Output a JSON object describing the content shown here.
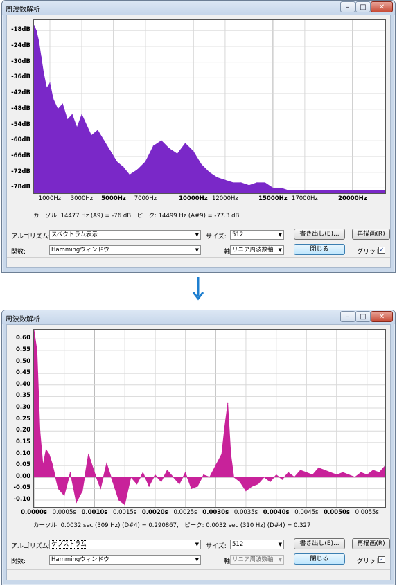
{
  "window_title": "周波数解析",
  "colors": {
    "spectrum": "#7a28c8",
    "cepstrum": "#c8229a",
    "transition_arrow": "#1e7fd0"
  },
  "icons": {
    "transition": "down-arrow-icon",
    "minimize": "minimize-icon",
    "maximize": "maximize-icon",
    "close": "close-icon",
    "check": "check-icon"
  },
  "window_buttons": {
    "minimize": "–",
    "maximize": "□",
    "close": "✕"
  },
  "top": {
    "chart_data": {
      "type": "area",
      "title": "",
      "xlabel": "",
      "ylabel": "",
      "ylim": [
        -80,
        -14
      ],
      "xlim": [
        0,
        22050
      ],
      "grid": true,
      "y_ticks": [
        "-18dB",
        "-24dB",
        "-30dB",
        "-36dB",
        "-42dB",
        "-48dB",
        "-54dB",
        "-60dB",
        "-66dB",
        "-72dB",
        "-78dB"
      ],
      "x_ticks": [
        {
          "label": "1000Hz",
          "value": 1000,
          "bold": false
        },
        {
          "label": "3000Hz",
          "value": 3000,
          "bold": false
        },
        {
          "label": "5000Hz",
          "value": 5000,
          "bold": true
        },
        {
          "label": "7000Hz",
          "value": 7000,
          "bold": false
        },
        {
          "label": "10000Hz",
          "value": 10000,
          "bold": true
        },
        {
          "label": "12000Hz",
          "value": 12000,
          "bold": false
        },
        {
          "label": "15000Hz",
          "value": 15000,
          "bold": true
        },
        {
          "label": "17000Hz",
          "value": 17000,
          "bold": false
        },
        {
          "label": "20000Hz",
          "value": 20000,
          "bold": true
        }
      ],
      "x": [
        0,
        150,
        300,
        450,
        600,
        800,
        1000,
        1200,
        1500,
        1800,
        2100,
        2400,
        2700,
        3000,
        3300,
        3600,
        4000,
        4400,
        4800,
        5200,
        5600,
        6000,
        6500,
        7000,
        7500,
        8000,
        8500,
        9000,
        9500,
        10000,
        10500,
        11000,
        11500,
        12000,
        12500,
        13000,
        13500,
        14000,
        14500,
        15000,
        15500,
        16000,
        17000,
        18000,
        19000,
        20000,
        21000,
        22050
      ],
      "y": [
        -16,
        -18,
        -22,
        -28,
        -34,
        -40,
        -38,
        -44,
        -48,
        -46,
        -52,
        -50,
        -55,
        -50,
        -54,
        -58,
        -56,
        -60,
        -64,
        -68,
        -70,
        -73,
        -71,
        -68,
        -62,
        -60,
        -63,
        -65,
        -61,
        -64,
        -69,
        -72,
        -74,
        -75,
        -76,
        -76,
        -77,
        -76,
        -76,
        -78,
        -78,
        -79,
        -79,
        -79,
        -79,
        -79,
        -79,
        -79
      ]
    },
    "readout": "カーソル: 14477 Hz (A9) = -76 dB　ピーク: 14499 Hz (A#9) = -77.3 dB",
    "controls": {
      "algorithm_label": "アルゴリズム:",
      "algorithm_value": "スペクトラム表示",
      "function_label": "関数:",
      "function_value": "Hammingウィンドウ",
      "size_label": "サイズ:",
      "size_value": "512",
      "axis_label": "軸:",
      "axis_value": "リニア周波数軸",
      "export_button": "書き出し(E)...",
      "replot_button": "再描画(R)",
      "close_button": "閉じる",
      "grid_label": "グリッド",
      "grid_checked": true
    }
  },
  "bottom": {
    "chart_data": {
      "type": "area",
      "title": "",
      "xlabel": "",
      "ylabel": "",
      "ylim": [
        -0.13,
        0.64
      ],
      "xlim": [
        0,
        0.0058
      ],
      "grid": true,
      "y_ticks": [
        "0.60",
        "0.55",
        "0.50",
        "0.45",
        "0.40",
        "0.35",
        "0.30",
        "0.25",
        "0.20",
        "0.15",
        "0.10",
        "0.05",
        "0.00",
        "-0.05",
        "-0.10"
      ],
      "x_ticks": [
        {
          "label": "0.0000s",
          "value": 0.0,
          "bold": true
        },
        {
          "label": "0.0005s",
          "value": 0.0005,
          "bold": false
        },
        {
          "label": "0.0010s",
          "value": 0.001,
          "bold": true
        },
        {
          "label": "0.0015s",
          "value": 0.0015,
          "bold": false
        },
        {
          "label": "0.0020s",
          "value": 0.002,
          "bold": true
        },
        {
          "label": "0.0025s",
          "value": 0.0025,
          "bold": false
        },
        {
          "label": "0.0030s",
          "value": 0.003,
          "bold": true
        },
        {
          "label": "0.0035s",
          "value": 0.0035,
          "bold": false
        },
        {
          "label": "0.0040s",
          "value": 0.004,
          "bold": true
        },
        {
          "label": "0.0045s",
          "value": 0.0045,
          "bold": false
        },
        {
          "label": "0.0050s",
          "value": 0.005,
          "bold": true
        },
        {
          "label": "0.0055s",
          "value": 0.0055,
          "bold": false
        }
      ],
      "x": [
        0,
        5e-05,
        0.0001,
        0.00015,
        0.0002,
        0.00025,
        0.0003,
        0.0004,
        0.0005,
        0.0006,
        0.0007,
        0.0008,
        0.0009,
        0.001,
        0.0011,
        0.0012,
        0.0013,
        0.0014,
        0.0015,
        0.0016,
        0.0017,
        0.0018,
        0.0019,
        0.002,
        0.0021,
        0.0022,
        0.0023,
        0.0024,
        0.0025,
        0.0026,
        0.0027,
        0.0028,
        0.0029,
        0.003,
        0.0031,
        0.00315,
        0.0032,
        0.00325,
        0.0033,
        0.0034,
        0.0035,
        0.0036,
        0.0037,
        0.0038,
        0.0039,
        0.004,
        0.0041,
        0.0042,
        0.0043,
        0.0044,
        0.0045,
        0.0046,
        0.0047,
        0.0048,
        0.0049,
        0.005,
        0.0051,
        0.0052,
        0.0053,
        0.0054,
        0.0055,
        0.0056,
        0.0057,
        0.0058
      ],
      "y": [
        0.64,
        0.55,
        0.2,
        0.05,
        0.12,
        0.1,
        0.06,
        -0.05,
        -0.08,
        0.02,
        -0.11,
        -0.06,
        0.1,
        0.02,
        -0.05,
        0.06,
        -0.02,
        -0.1,
        -0.12,
        0.0,
        -0.03,
        0.02,
        -0.04,
        0.01,
        -0.02,
        0.03,
        0.0,
        -0.03,
        0.02,
        -0.05,
        -0.04,
        0.01,
        0.0,
        0.05,
        0.1,
        0.22,
        0.32,
        0.1,
        0.0,
        -0.02,
        -0.06,
        -0.04,
        -0.03,
        0.0,
        -0.02,
        0.01,
        -0.01,
        0.02,
        0.0,
        0.03,
        0.02,
        0.01,
        0.04,
        0.03,
        0.02,
        0.01,
        0.02,
        0.01,
        0.0,
        0.02,
        0.01,
        0.03,
        0.02,
        0.05
      ]
    },
    "readout": "カーソル: 0.0032 sec (309 Hz) (D#4) = 0.290867,　ピーク: 0.0032 sec (310 Hz) (D#4) = 0.327",
    "controls": {
      "algorithm_label": "アルゴリズム:",
      "algorithm_value": "ケプストラム",
      "function_label": "関数:",
      "function_value": "Hammingウィンドウ",
      "size_label": "サイズ:",
      "size_value": "512",
      "axis_label": "軸:",
      "axis_value": "リニア周波数軸",
      "export_button": "書き出し(E)...",
      "replot_button": "再描画(R)",
      "close_button": "閉じる",
      "grid_label": "グリッド",
      "grid_checked": true
    }
  }
}
